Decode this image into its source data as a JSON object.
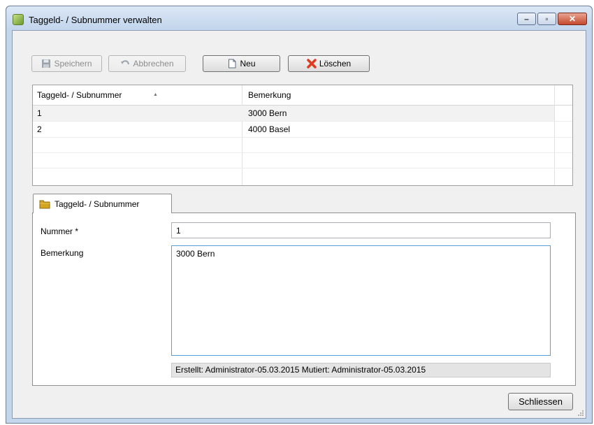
{
  "window": {
    "title": "Taggeld- / Subnummer verwalten"
  },
  "toolbar": {
    "save_label": "Speichern",
    "cancel_label": "Abbrechen",
    "new_label": "Neu",
    "delete_label": "Löschen"
  },
  "grid": {
    "columns": [
      "Taggeld- / Subnummer",
      "Bemerkung"
    ],
    "sort_indicator": "▲",
    "rows": [
      {
        "nummer": "1",
        "bemerkung": "3000 Bern"
      },
      {
        "nummer": "2",
        "bemerkung": "4000 Basel"
      }
    ]
  },
  "tab": {
    "label": "Taggeld- / Subnummer"
  },
  "form": {
    "nummer_label": "Nummer *",
    "nummer_value": "1",
    "bemerkung_label": "Bemerkung",
    "bemerkung_value": "3000 Bern",
    "audit_text": "Erstellt: Administrator-05.03.2015  Mutiert: Administrator-05.03.2015"
  },
  "footer": {
    "close_label": "Schliessen"
  },
  "icons": {
    "app": "app-icon",
    "save": "floppy-disk-icon",
    "cancel": "undo-icon",
    "new": "new-document-icon",
    "delete": "red-x-icon",
    "tab": "folder-icon"
  },
  "colors": {
    "selected_row": "#f2f2f2",
    "delete_icon": "#e03a1e"
  }
}
